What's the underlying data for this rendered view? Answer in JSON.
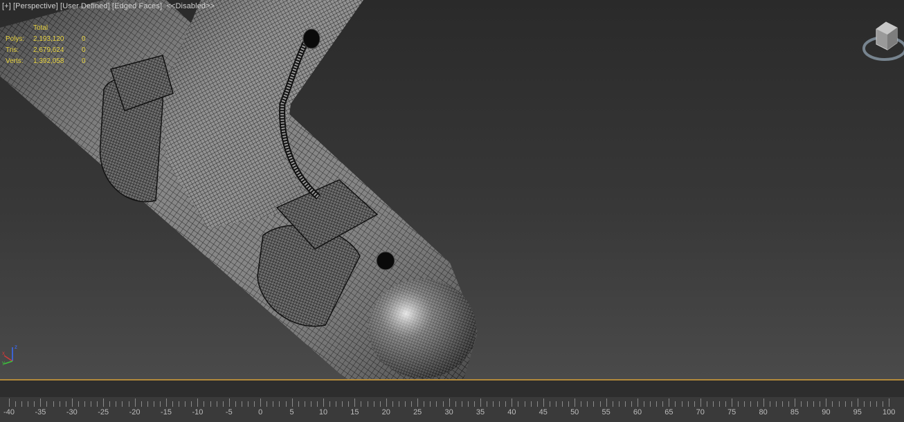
{
  "viewport": {
    "label_plus": "+",
    "label_view": "Perspective",
    "label_shading": "User Defined",
    "label_style": "Edged Faces",
    "label_status": "<<Disabled>>"
  },
  "stats": {
    "header": "Total",
    "rows": [
      {
        "label": "Polys:",
        "total": "2,193,120",
        "selected": "0"
      },
      {
        "label": "Tris:",
        "total": "2,679,624",
        "selected": "0"
      },
      {
        "label": "Verts:",
        "total": "1,392,058",
        "selected": "0"
      }
    ]
  },
  "axis": {
    "x": "x",
    "y": "y",
    "z": "z"
  },
  "timeline": {
    "labels": [
      "-40",
      "-35",
      "-30",
      "-25",
      "-20",
      "-15",
      "-10",
      "-5",
      "0",
      "5",
      "10",
      "15",
      "20",
      "25",
      "30",
      "35",
      "40",
      "45",
      "50",
      "55",
      "60",
      "65",
      "70",
      "75",
      "80",
      "85",
      "90",
      "95",
      "100"
    ]
  },
  "colors": {
    "stats_text": "#e8d33f",
    "track_line": "#b38a3a",
    "wire": "#111111"
  }
}
